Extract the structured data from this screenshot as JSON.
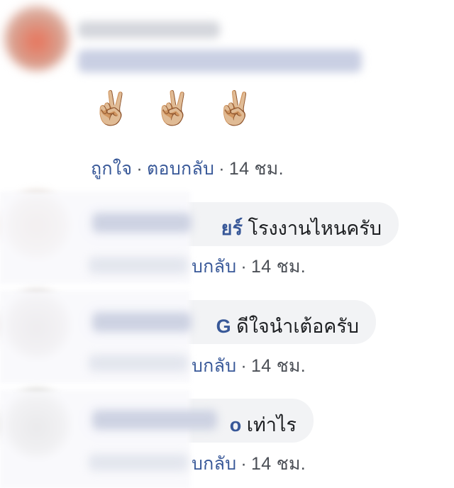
{
  "comments": [
    {
      "id": "c1",
      "emoji": [
        "✌🏼",
        "✌🏼",
        "✌🏼"
      ],
      "actions": {
        "like": "ถูกใจ",
        "reply": "ตอบกลับ",
        "time": "14 ชม."
      }
    },
    {
      "id": "c2",
      "name_tail": "ยร์",
      "text": "โรงงานไหนครับ",
      "actions": {
        "reply": "บกลับ",
        "time": "14 ชม."
      }
    },
    {
      "id": "c3",
      "name_tail": "G",
      "text": "ดีใจนำเต้อครับ",
      "actions": {
        "reply": "บกลับ",
        "time": "14 ชม."
      }
    },
    {
      "id": "c4",
      "name_tail": "o",
      "text": "เท่าไร",
      "actions": {
        "reply": "บกลับ",
        "time": "14 ชม."
      }
    }
  ],
  "colors": {
    "link": "#385898",
    "bubble": "#f2f3f5",
    "meta": "#4b4f56"
  }
}
